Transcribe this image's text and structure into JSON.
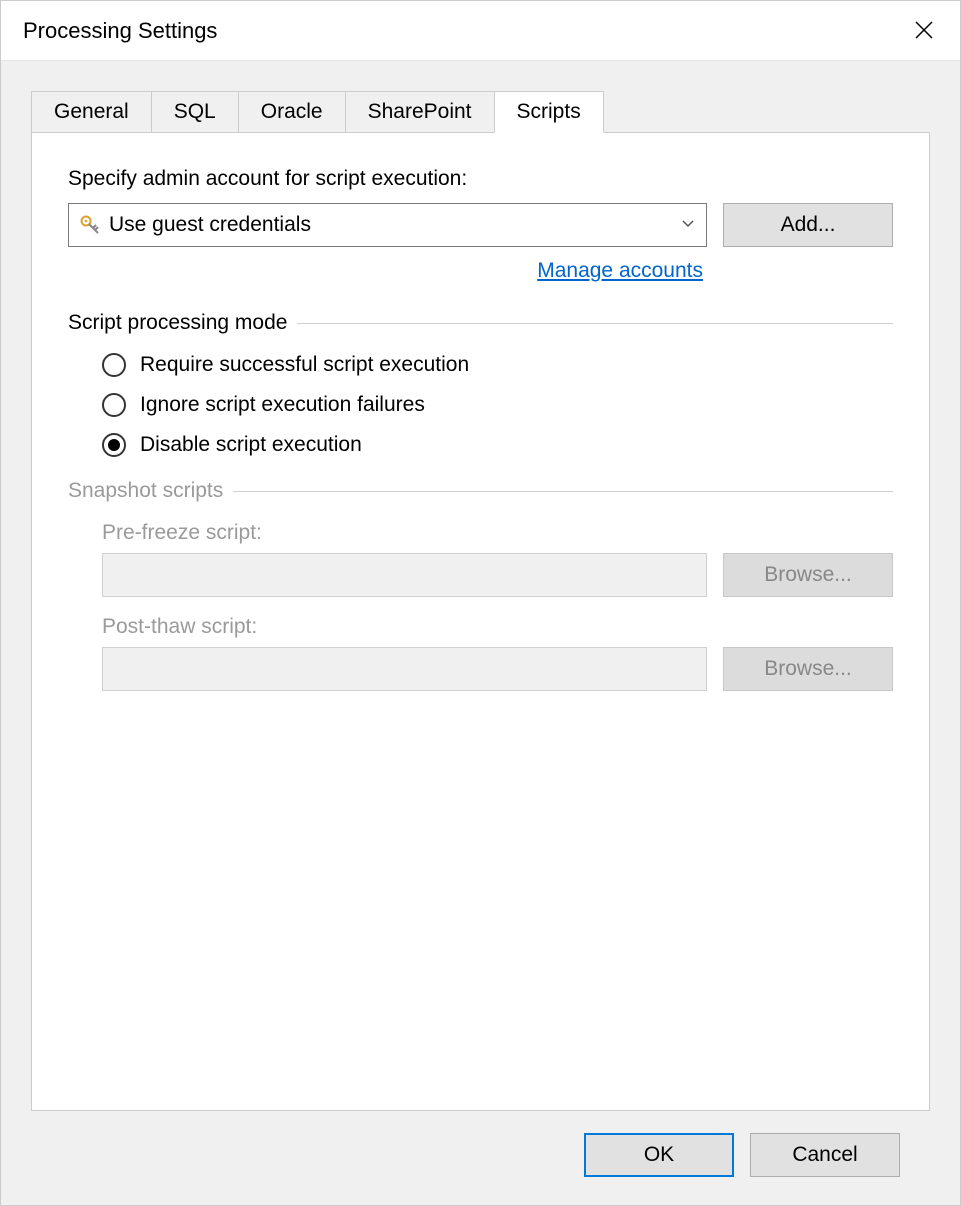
{
  "window": {
    "title": "Processing Settings"
  },
  "tabs": {
    "items": [
      {
        "label": "General"
      },
      {
        "label": "SQL"
      },
      {
        "label": "Oracle"
      },
      {
        "label": "SharePoint"
      },
      {
        "label": "Scripts"
      }
    ],
    "activeIndex": 4
  },
  "account": {
    "label": "Specify admin account for script execution:",
    "selected": "Use guest credentials",
    "addLabel": "Add...",
    "manageLinkLabel": "Manage accounts"
  },
  "processingMode": {
    "title": "Script processing mode",
    "selectedIndex": 2,
    "options": [
      "Require successful script execution",
      "Ignore script execution failures",
      "Disable script execution"
    ]
  },
  "snapshot": {
    "title": "Snapshot scripts",
    "preFreezeLabel": "Pre-freeze script:",
    "preFreezeValue": "",
    "postThawLabel": "Post-thaw script:",
    "postThawValue": "",
    "browseLabel": "Browse..."
  },
  "footer": {
    "okLabel": "OK",
    "cancelLabel": "Cancel"
  }
}
